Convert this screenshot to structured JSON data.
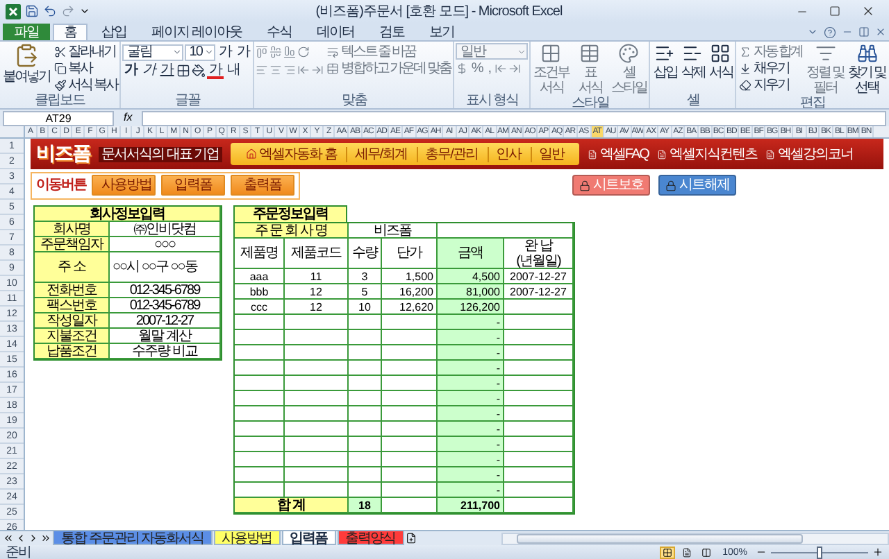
{
  "window": {
    "title": "(비즈폼)주문서 [호환 모드] - Microsoft Excel"
  },
  "ribbon_tabs": [
    {
      "label": "파일",
      "kind": "file",
      "selected": false
    },
    {
      "label": "홈",
      "kind": "tab",
      "selected": true
    },
    {
      "label": "삽입",
      "kind": "tab",
      "selected": false
    },
    {
      "label": "페이지 레이아웃",
      "kind": "tab",
      "selected": false
    },
    {
      "label": "수식",
      "kind": "tab",
      "selected": false
    },
    {
      "label": "데이터",
      "kind": "tab",
      "selected": false
    },
    {
      "label": "검토",
      "kind": "tab",
      "selected": false
    },
    {
      "label": "보기",
      "kind": "tab",
      "selected": false
    }
  ],
  "ribbon": {
    "groups": [
      {
        "kind": "clipboard",
        "label": "클립보드",
        "paste": "붙여넣기",
        "items": [
          "잘라내기",
          "복사",
          "서식 복사"
        ]
      },
      {
        "kind": "font",
        "label": "글꼴",
        "font": "굴림",
        "size": "10",
        "grow": "가",
        "shrink": "가",
        "styles": [
          "가",
          "가",
          "가"
        ],
        "font_color": "가",
        "phonetic": "내"
      },
      {
        "kind": "alignment",
        "label": "맞춤",
        "disabled": true,
        "wrap": "텍스트 줄 바꿈",
        "merge": "병합하고 가운데 맞춤"
      },
      {
        "kind": "number",
        "label": "표시 형식",
        "disabled": true,
        "format": "일반",
        "percent": "%",
        "comma": ","
      },
      {
        "kind": "styles",
        "label": "스타일",
        "disabled": true,
        "buttons": [
          "조건부 서식",
          "표 서식",
          "셀 스타일"
        ]
      },
      {
        "kind": "cells",
        "label": "셀",
        "disabled": false,
        "buttons": [
          "삽입",
          "삭제",
          "서식"
        ]
      },
      {
        "kind": "editing",
        "label": "편집",
        "items": [
          {
            "label": "자동 합계",
            "disabled": true
          },
          {
            "label": "채우기",
            "disabled": false
          },
          {
            "label": "지우기",
            "disabled": false
          }
        ],
        "buttons": [
          {
            "label": "정렬 및 필터",
            "disabled": true
          },
          {
            "label": "찾기 및 선택",
            "disabled": false
          }
        ]
      }
    ]
  },
  "formula_bar": {
    "name_box": "AT29",
    "function_label": "fx"
  },
  "sheet": {
    "columns": [
      {
        "label": "A",
        "selected": false
      },
      {
        "label": "B",
        "selected": false
      },
      {
        "label": "C",
        "selected": false
      },
      {
        "label": "D",
        "selected": false
      },
      {
        "label": "E",
        "selected": false
      },
      {
        "label": "F",
        "selected": false
      },
      {
        "label": "G",
        "selected": false
      },
      {
        "label": "H",
        "selected": false
      },
      {
        "label": "I",
        "selected": false
      },
      {
        "label": "J",
        "selected": false
      },
      {
        "label": "K",
        "selected": false
      },
      {
        "label": "L",
        "selected": false
      },
      {
        "label": "M",
        "selected": false
      },
      {
        "label": "N",
        "selected": false
      },
      {
        "label": "O",
        "selected": false
      },
      {
        "label": "P",
        "selected": false
      },
      {
        "label": "Q",
        "selected": false
      },
      {
        "label": "R",
        "selected": false
      },
      {
        "label": "S",
        "selected": false
      },
      {
        "label": "T",
        "selected": false
      },
      {
        "label": "U",
        "selected": false
      },
      {
        "label": "V",
        "selected": false
      },
      {
        "label": "W",
        "selected": false
      },
      {
        "label": "X",
        "selected": false
      },
      {
        "label": "Y",
        "selected": false
      },
      {
        "label": "Z",
        "selected": false
      },
      {
        "label": "AA",
        "selected": false
      },
      {
        "label": "AB",
        "selected": false
      },
      {
        "label": "AC",
        "selected": false
      },
      {
        "label": "AD",
        "selected": false
      },
      {
        "label": "AE",
        "selected": false
      },
      {
        "label": "AF",
        "selected": false
      },
      {
        "label": "AG",
        "selected": false
      },
      {
        "label": "AH",
        "selected": false
      },
      {
        "label": "AI",
        "selected": false
      },
      {
        "label": "AJ",
        "selected": false
      },
      {
        "label": "AK",
        "selected": false
      },
      {
        "label": "AL",
        "selected": false
      },
      {
        "label": "AM",
        "selected": false
      },
      {
        "label": "AN",
        "selected": false
      },
      {
        "label": "AO",
        "selected": false
      },
      {
        "label": "AP",
        "selected": false
      },
      {
        "label": "AQ",
        "selected": false
      },
      {
        "label": "AR",
        "selected": false
      },
      {
        "label": "AS",
        "selected": false
      },
      {
        "label": "AT",
        "selected": true
      },
      {
        "label": "AU",
        "selected": false
      },
      {
        "label": "AV",
        "selected": false
      },
      {
        "label": "AW",
        "selected": false
      },
      {
        "label": "AX",
        "selected": false
      },
      {
        "label": "AY",
        "selected": false
      },
      {
        "label": "AZ",
        "selected": false
      },
      {
        "label": "BA",
        "selected": false
      },
      {
        "label": "BB",
        "selected": false
      },
      {
        "label": "BC",
        "selected": false
      },
      {
        "label": "BD",
        "selected": false
      },
      {
        "label": "BE",
        "selected": false
      },
      {
        "label": "BF",
        "selected": false
      },
      {
        "label": "BG",
        "selected": false
      },
      {
        "label": "BH",
        "selected": false
      },
      {
        "label": "BI",
        "selected": false
      },
      {
        "label": "BJ",
        "selected": false
      },
      {
        "label": "BK",
        "selected": false
      },
      {
        "label": "BL",
        "selected": false
      },
      {
        "label": "BM",
        "selected": false
      },
      {
        "label": "BN",
        "selected": false
      }
    ],
    "rows": [
      "1",
      "2",
      "3",
      "4",
      "5",
      "6",
      "7",
      "8",
      "9",
      "10",
      "11",
      "12",
      "13",
      "14",
      "15",
      "16",
      "17",
      "18",
      "19",
      "20",
      "21",
      "22",
      "23",
      "24",
      "25",
      "26"
    ]
  },
  "banner": {
    "logo": "비즈폼",
    "logo_sub": "문서서식의 대표 기업",
    "nav": [
      {
        "label": "엑셀자동화 홈",
        "kind": "home"
      },
      {
        "label": "세무/회계",
        "kind": "link"
      },
      {
        "label": "총무/관리",
        "kind": "link"
      },
      {
        "label": "인사",
        "kind": "link"
      },
      {
        "label": "일반",
        "kind": "link"
      }
    ],
    "links": [
      "엑셀FAQ",
      "엑셀지식컨텐츠",
      "엑셀강의코너"
    ]
  },
  "nav_panel": {
    "label": "이동버튼",
    "buttons": [
      "사용방법",
      "입력폼",
      "출력폼"
    ]
  },
  "protect_buttons": [
    {
      "label": "시트보호",
      "color": "#f07a72"
    },
    {
      "label": "시트해제",
      "color": "#4a86d0"
    }
  ],
  "company_info": {
    "title": "회사정보입력",
    "fields": [
      {
        "label": "회사명",
        "value": "㈜인비닷컴",
        "kind": "normal"
      },
      {
        "label": "주문책임자",
        "value": "○○○",
        "kind": "normal"
      },
      {
        "label": "주 소",
        "value": "○○시 ○○구 ○○동",
        "kind": "tall"
      },
      {
        "label": "전화번호",
        "value": "012-345-6789",
        "kind": "normal"
      },
      {
        "label": "팩스번호",
        "value": "012-345-6789",
        "kind": "normal"
      },
      {
        "label": "작성일자",
        "value": "2007-12-27",
        "kind": "normal"
      },
      {
        "label": "지불조건",
        "value": "월말 계산",
        "kind": "normal"
      },
      {
        "label": "납품조건",
        "value": "수주량 비교",
        "kind": "normal"
      }
    ]
  },
  "order_info": {
    "title": "주문정보입력",
    "company_label": "주 문 회 사 명",
    "company_value": "비즈폼",
    "columns": [
      {
        "label": "제품명"
      },
      {
        "label": "제품코드"
      },
      {
        "label": "수량"
      },
      {
        "label": "단가"
      },
      {
        "label": "금액"
      },
      {
        "label": "완 납",
        "sub": "(년월일)"
      }
    ],
    "rows": [
      {
        "product": "aaa",
        "code": "11",
        "qty": "3",
        "price": "1,500",
        "amount": "4,500",
        "delivered": "2007-12-27"
      },
      {
        "product": "bbb",
        "code": "12",
        "qty": "5",
        "price": "16,200",
        "amount": "81,000",
        "delivered": "2007-12-27"
      },
      {
        "product": "ccc",
        "code": "12",
        "qty": "10",
        "price": "12,620",
        "amount": "126,200"
      },
      {
        "amount": "-"
      },
      {
        "amount": "-"
      },
      {
        "amount": "-"
      },
      {
        "amount": "-"
      },
      {
        "amount": "-"
      },
      {
        "amount": "-"
      },
      {
        "amount": "-"
      },
      {
        "amount": "-"
      },
      {
        "amount": "-"
      },
      {
        "amount": "-"
      },
      {
        "amount": "-"
      },
      {
        "amount": "-"
      }
    ],
    "total": {
      "label": "합 계",
      "qty": "18",
      "amount": "211,700"
    }
  },
  "sheet_tabs": [
    {
      "label": "통합 주문관리 자동화서식",
      "color": "#5b8ee6",
      "selected": false
    },
    {
      "label": "사용방법",
      "color": "#ffff66",
      "selected": false
    },
    {
      "label": "입력폼",
      "selected": true
    },
    {
      "label": "출력양식",
      "color": "#ff3b3b",
      "selected": false
    }
  ],
  "status_bar": {
    "status": "준비",
    "views": [
      {
        "kind": "normal",
        "selected": true
      },
      {
        "kind": "layout",
        "selected": false
      },
      {
        "kind": "pagebreak",
        "selected": false
      }
    ],
    "zoom": "100%",
    "zoom_slider": {
      "level": 0.5
    }
  }
}
